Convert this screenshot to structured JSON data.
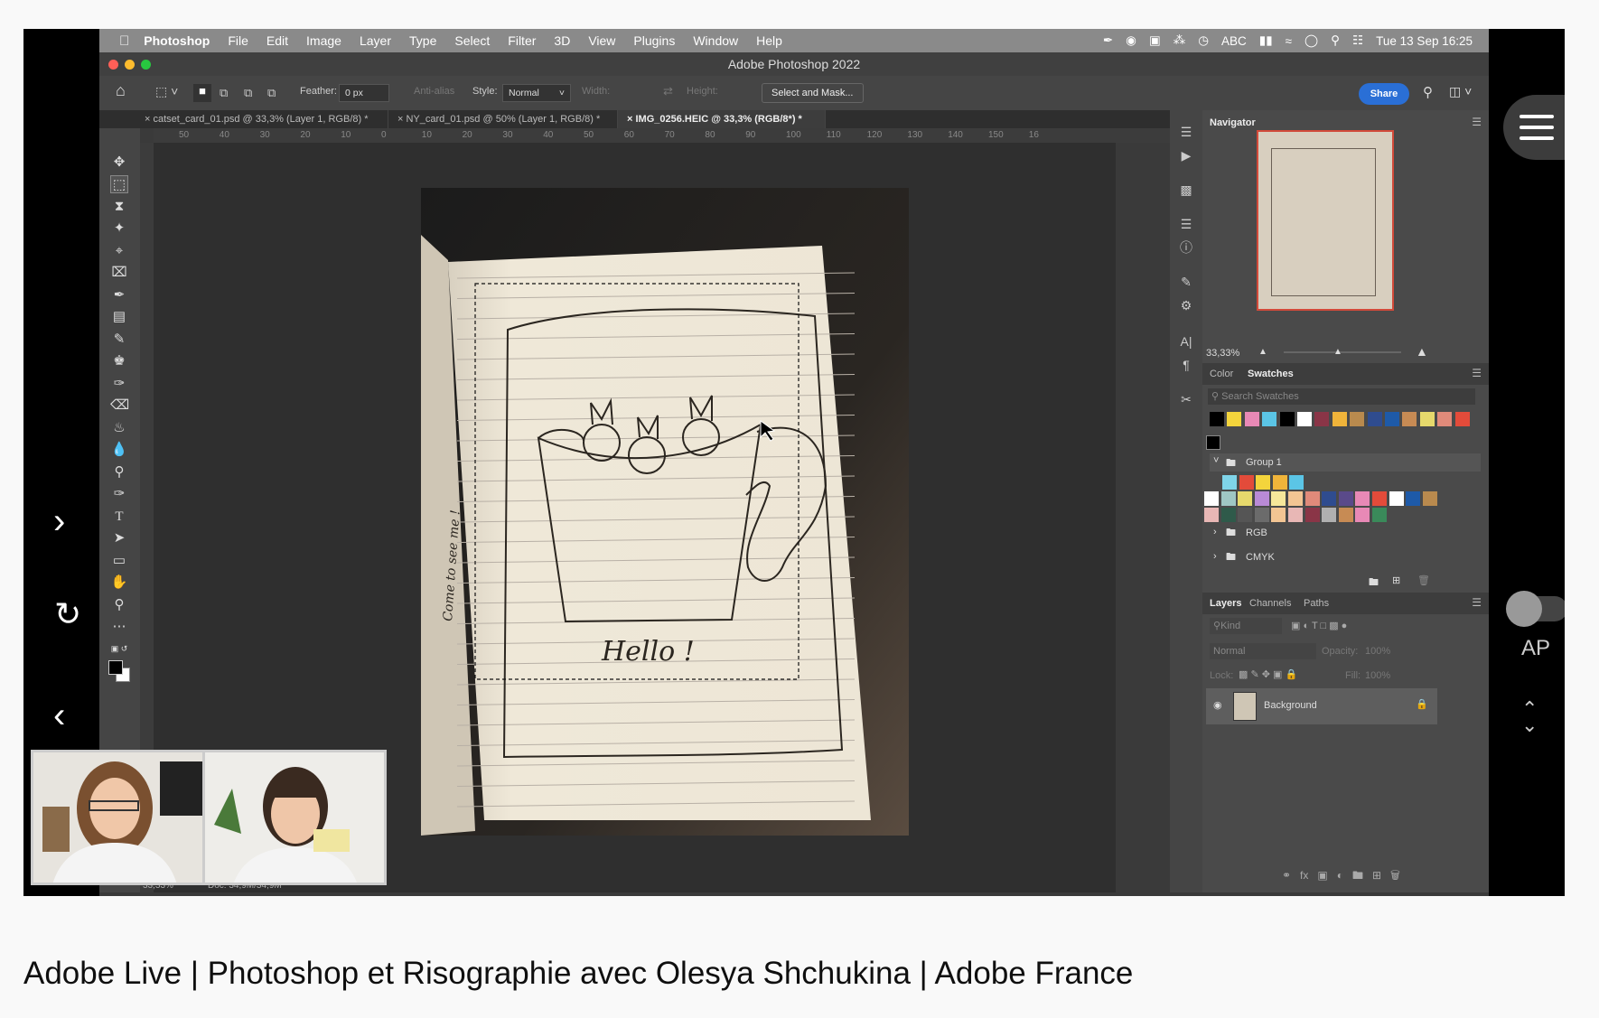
{
  "caption": "Adobe Live | Photoshop et Risographie avec Olesya Shchukina | Adobe France",
  "menubar": {
    "app": "Photoshop",
    "items": [
      "File",
      "Edit",
      "Image",
      "Layer",
      "Type",
      "Select",
      "Filter",
      "3D",
      "View",
      "Plugins",
      "Window",
      "Help"
    ],
    "input_source": "ABC",
    "datetime": "Tue 13 Sep  16:25"
  },
  "window": {
    "title": "Adobe Photoshop 2022"
  },
  "options": {
    "feather_label": "Feather:",
    "feather_value": "0 px",
    "antialias": "Anti-alias",
    "style_label": "Style:",
    "style_value": "Normal",
    "width_label": "Width:",
    "height_label": "Height:",
    "select_mask": "Select and Mask...",
    "share": "Share"
  },
  "tabs": [
    "catset_card_01.psd @ 33,3% (Layer 1, RGB/8) *",
    "NY_card_01.psd @ 50% (Layer 1, RGB/8) *",
    "IMG_0256.HEIC @ 33,3% (RGB/8*) *"
  ],
  "ruler_ticks": [
    "50",
    "40",
    "30",
    "20",
    "10",
    "0",
    "10",
    "20",
    "30",
    "40",
    "50",
    "60",
    "70",
    "80",
    "90",
    "100",
    "110",
    "120",
    "130",
    "140",
    "150",
    "16"
  ],
  "document": {
    "hello_text": "Hello !",
    "side_text": "Come to see me !"
  },
  "navigator": {
    "title": "Navigator",
    "zoom": "33,33%"
  },
  "swatches": {
    "tab_color": "Color",
    "tab_swatches": "Swatches",
    "search_placeholder": "Search Swatches",
    "group1": "Group 1",
    "rgb": "RGB",
    "cmyk": "CMYK",
    "recent_colors": [
      "#000000",
      "#f3d43c",
      "#e889b6",
      "#5bc5e6",
      "#000000",
      "#ffffff",
      "#8a3547",
      "#f0b43a",
      "#b98a4e",
      "#2f4c8f",
      "#1e5aa8",
      "#c78b54",
      "#e6d96c",
      "#e08a7a",
      "#e34b3a"
    ],
    "group1_colors_row1": [
      "#7fd4e8",
      "#e34b3a",
      "#f3d43c",
      "#f0b43a",
      "#5bc5e6"
    ],
    "group1_colors_row2": [
      "#ffffff",
      "#9fc7c4",
      "#e6d96c",
      "#b98ad6",
      "#f6e79a",
      "#f3c593",
      "#e08a7a",
      "#2f4c8f",
      "#5a4a8a",
      "#e889b6",
      "#e34b3a",
      "#ffffff",
      "#1e5aa8",
      "#b98a4e"
    ],
    "group1_colors_row3": [
      "#e8b7b5",
      "#2f5a4a",
      "#555555",
      "#6b6b6b",
      "#f3c593",
      "#e8b7b5",
      "#8a3547",
      "#b0b0b0",
      "#c78b54",
      "#e889b6",
      "#3a8a5a"
    ]
  },
  "layers": {
    "tab_layers": "Layers",
    "tab_channels": "Channels",
    "tab_paths": "Paths",
    "kind": "Kind",
    "blend": "Normal",
    "opacity_label": "Opacity:",
    "opacity_value": "100%",
    "lock_label": "Lock:",
    "fill_label": "Fill:",
    "fill_value": "100%",
    "background_layer": "Background"
  },
  "status": {
    "zoom": "33,33%",
    "doc": "Doc: 34,9M/34,9M"
  },
  "overlay": {
    "ap": "AP"
  }
}
